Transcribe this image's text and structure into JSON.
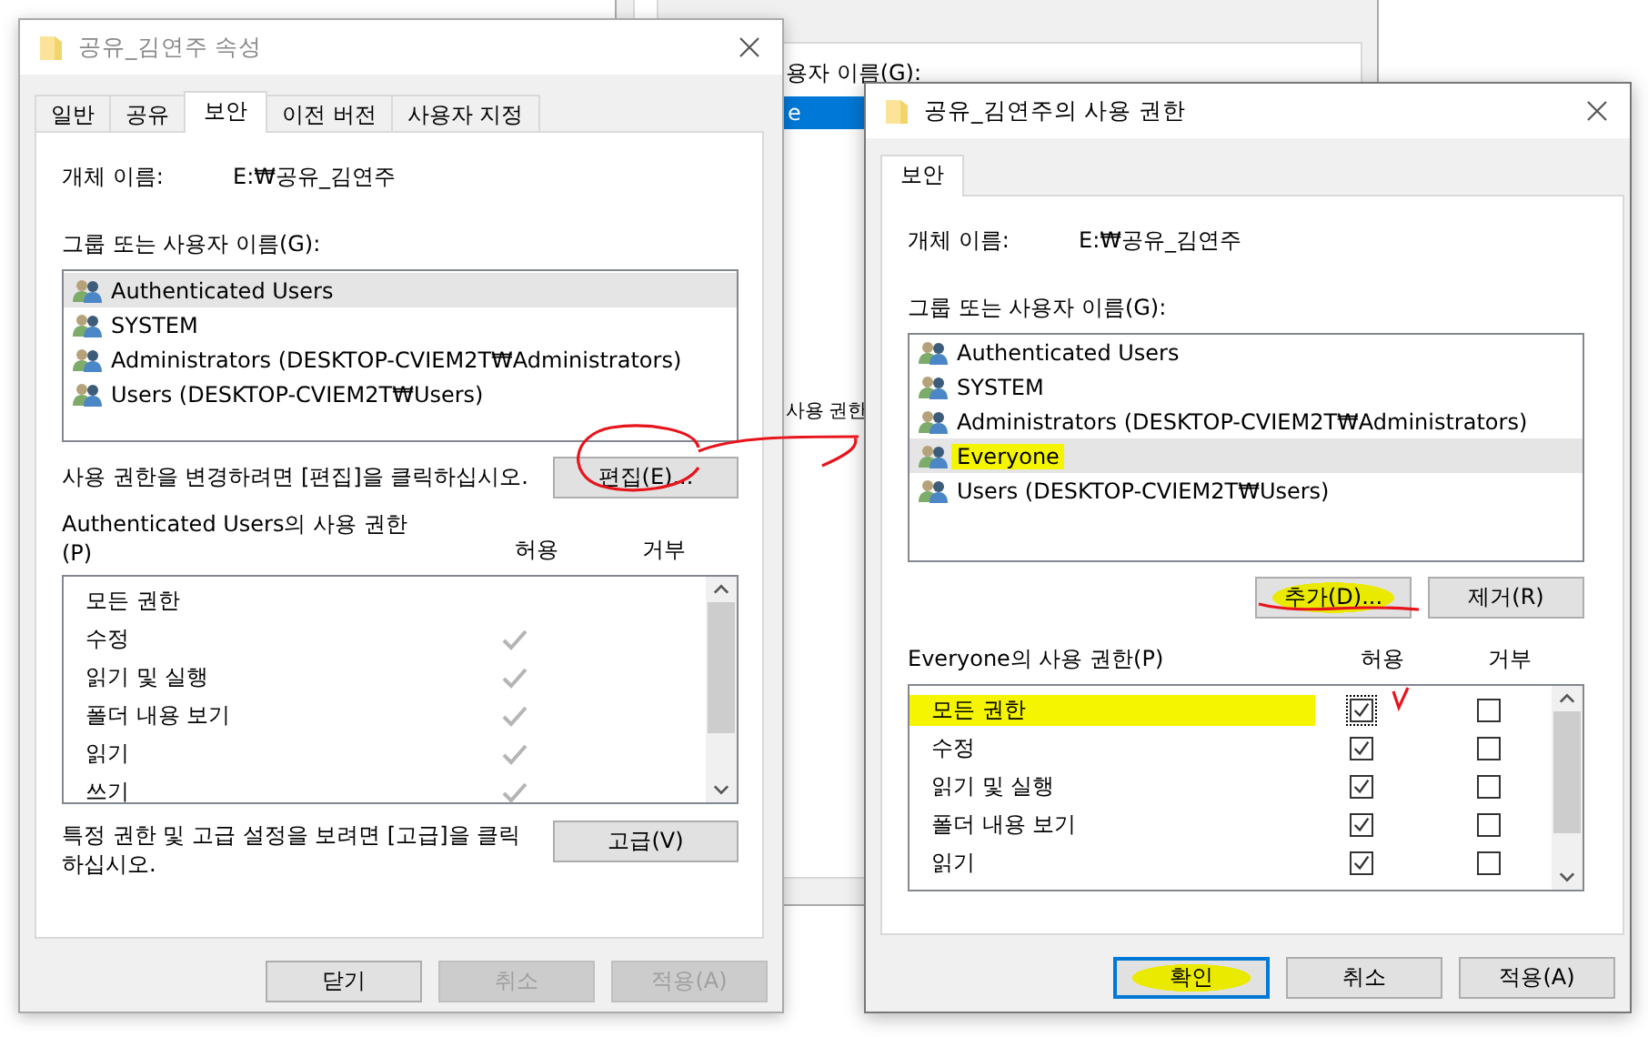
{
  "background_window": {
    "group_label": "용자 이름(G):",
    "selected_row": "e",
    "permissions_label": "사용 권한"
  },
  "properties_dialog": {
    "title": "공유_김연주 속성",
    "active": false,
    "tabs": [
      {
        "label": "일반",
        "selected": false
      },
      {
        "label": "공유",
        "selected": false
      },
      {
        "label": "보안",
        "selected": true
      },
      {
        "label": "이전 버전",
        "selected": false
      },
      {
        "label": "사용자 지정",
        "selected": false
      }
    ],
    "object_name_label": "개체 이름:",
    "object_name": "E:₩공유_김연주",
    "group_label": "그룹 또는 사용자 이름(G):",
    "users": [
      {
        "name": "Authenticated Users",
        "selected": true
      },
      {
        "name": "SYSTEM",
        "selected": false
      },
      {
        "name": "Administrators (DESKTOP-CVIEM2T₩Administrators)",
        "selected": false
      },
      {
        "name": "Users (DESKTOP-CVIEM2T₩Users)",
        "selected": false
      }
    ],
    "edit_hint": "사용 권한을 변경하려면 [편집]을 클릭하십시오.",
    "edit_button": "편집(E)...",
    "permissions_label": "Authenticated Users의 사용 권한",
    "permissions_label_2": "(P)",
    "allow_header": "허용",
    "deny_header": "거부",
    "permissions": [
      {
        "name": "모든 권한",
        "allow": false
      },
      {
        "name": "수정",
        "allow": true
      },
      {
        "name": "읽기 및 실행",
        "allow": true
      },
      {
        "name": "폴더 내용 보기",
        "allow": true
      },
      {
        "name": "읽기",
        "allow": true
      },
      {
        "name": "쓰기",
        "allow": true
      }
    ],
    "advanced_hint": "특정 권한 및 고급 설정을 보려면 [고급]을 클릭 하십시오.",
    "advanced_button": "고급(V)",
    "buttons": [
      {
        "label": "닫기",
        "disabled": false,
        "default": false
      },
      {
        "label": "취소",
        "disabled": true,
        "default": false
      },
      {
        "label": "적용(A)",
        "disabled": true,
        "default": false
      }
    ]
  },
  "permissions_dialog": {
    "title": "공유_김연주의 사용 권한",
    "active": true,
    "tabs": [
      {
        "label": "보안",
        "selected": true
      }
    ],
    "object_name_label": "개체 이름:",
    "object_name": "E:₩공유_김연주",
    "group_label": "그룹 또는 사용자 이름(G):",
    "users": [
      {
        "name": "Authenticated Users",
        "selected": false,
        "highlighted": false
      },
      {
        "name": "SYSTEM",
        "selected": false,
        "highlighted": false
      },
      {
        "name": "Administrators (DESKTOP-CVIEM2T₩Administrators)",
        "selected": false,
        "highlighted": false
      },
      {
        "name": "Everyone",
        "selected": true,
        "highlighted": true
      },
      {
        "name": "Users (DESKTOP-CVIEM2T₩Users)",
        "selected": false,
        "highlighted": false
      }
    ],
    "list_buttons": [
      {
        "label": "추가(D)...",
        "highlighted": true
      },
      {
        "label": "제거(R)",
        "highlighted": false
      }
    ],
    "permissions_label": "Everyone의 사용 권한(P)",
    "allow_header": "허용",
    "deny_header": "거부",
    "permissions": [
      {
        "name": "모든 권한",
        "allow": true,
        "deny": false,
        "focused": true,
        "highlighted": true
      },
      {
        "name": "수정",
        "allow": true,
        "deny": false,
        "focused": false,
        "highlighted": false
      },
      {
        "name": "읽기 및 실행",
        "allow": true,
        "deny": false,
        "focused": false,
        "highlighted": false
      },
      {
        "name": "폴더 내용 보기",
        "allow": true,
        "deny": false,
        "focused": false,
        "highlighted": false
      },
      {
        "name": "읽기",
        "allow": true,
        "deny": false,
        "focused": false,
        "highlighted": false
      }
    ],
    "buttons": [
      {
        "label": "확인",
        "disabled": false,
        "default": true,
        "highlighted": true
      },
      {
        "label": "취소",
        "disabled": false,
        "default": false,
        "highlighted": false
      },
      {
        "label": "적용(A)",
        "disabled": false,
        "default": false,
        "highlighted": false
      }
    ]
  }
}
